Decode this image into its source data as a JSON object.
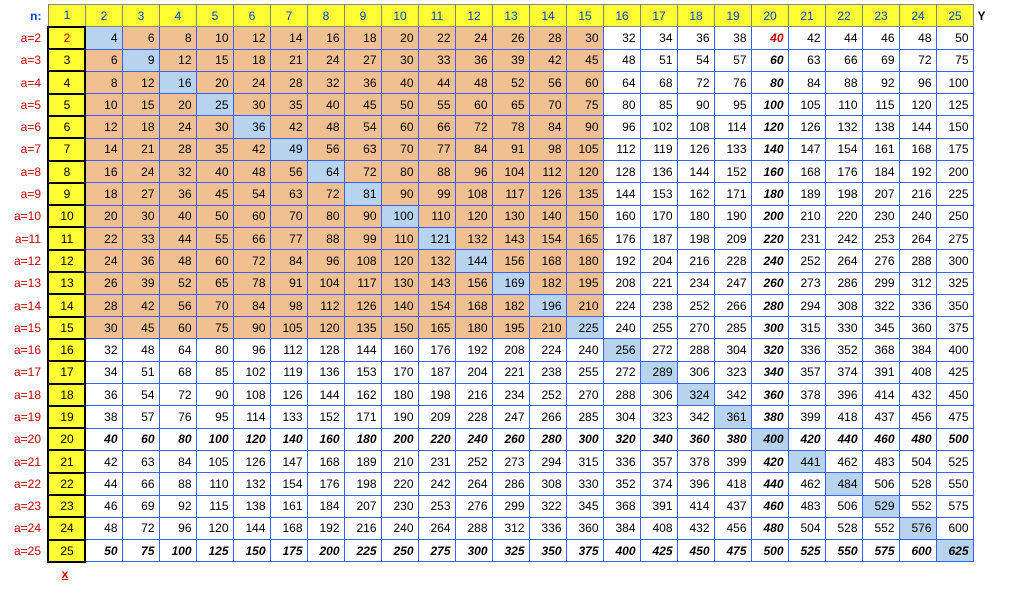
{
  "labels": {
    "n": "n:",
    "aPrefix": "a=",
    "x": "x",
    "y": "Y"
  },
  "cols": [
    1,
    2,
    3,
    4,
    5,
    6,
    7,
    8,
    9,
    10,
    11,
    12,
    13,
    14,
    15,
    16,
    17,
    18,
    19,
    20,
    21,
    22,
    23,
    24,
    25
  ],
  "rows": [
    2,
    3,
    4,
    5,
    6,
    7,
    8,
    9,
    10,
    11,
    12,
    13,
    14,
    15,
    16,
    17,
    18,
    19,
    20,
    21,
    22,
    23,
    24,
    25
  ],
  "shadeUntil": 15,
  "boldItalicRows": [
    20,
    25
  ],
  "boldItalicCols": [
    20
  ],
  "a2RedCols": [
    1,
    20
  ],
  "chart_data": {
    "type": "table",
    "title": "Multiplication table a × n",
    "xlabel": "n",
    "ylabel": "a",
    "x": [
      1,
      2,
      3,
      4,
      5,
      6,
      7,
      8,
      9,
      10,
      11,
      12,
      13,
      14,
      15,
      16,
      17,
      18,
      19,
      20,
      21,
      22,
      23,
      24,
      25
    ],
    "series": [
      {
        "name": "a=2",
        "values": [
          2,
          4,
          6,
          8,
          10,
          12,
          14,
          16,
          18,
          20,
          22,
          24,
          26,
          28,
          30,
          32,
          34,
          36,
          38,
          40,
          42,
          44,
          46,
          48,
          50
        ]
      },
      {
        "name": "a=3",
        "values": [
          3,
          6,
          9,
          12,
          15,
          18,
          21,
          24,
          27,
          30,
          33,
          36,
          39,
          42,
          45,
          48,
          51,
          54,
          57,
          60,
          63,
          66,
          69,
          72,
          75
        ]
      },
      {
        "name": "a=4",
        "values": [
          4,
          8,
          12,
          16,
          20,
          24,
          28,
          32,
          36,
          40,
          44,
          48,
          52,
          56,
          60,
          64,
          68,
          72,
          76,
          80,
          84,
          88,
          92,
          96,
          100
        ]
      },
      {
        "name": "a=5",
        "values": [
          5,
          10,
          15,
          20,
          25,
          30,
          35,
          40,
          45,
          50,
          55,
          60,
          65,
          70,
          75,
          80,
          85,
          90,
          95,
          100,
          105,
          110,
          115,
          120,
          125
        ]
      },
      {
        "name": "a=6",
        "values": [
          6,
          12,
          18,
          24,
          30,
          36,
          42,
          48,
          54,
          60,
          66,
          72,
          78,
          84,
          90,
          96,
          102,
          108,
          114,
          120,
          126,
          132,
          138,
          144,
          150
        ]
      },
      {
        "name": "a=7",
        "values": [
          7,
          14,
          21,
          28,
          35,
          42,
          49,
          56,
          63,
          70,
          77,
          84,
          91,
          98,
          105,
          112,
          119,
          126,
          133,
          140,
          147,
          154,
          161,
          168,
          175
        ]
      },
      {
        "name": "a=8",
        "values": [
          8,
          16,
          24,
          32,
          40,
          48,
          56,
          64,
          72,
          80,
          88,
          96,
          104,
          112,
          120,
          128,
          136,
          144,
          152,
          160,
          168,
          176,
          184,
          192,
          200
        ]
      },
      {
        "name": "a=9",
        "values": [
          9,
          18,
          27,
          36,
          45,
          54,
          63,
          72,
          81,
          90,
          99,
          108,
          117,
          126,
          135,
          144,
          153,
          162,
          171,
          180,
          189,
          198,
          207,
          216,
          225
        ]
      },
      {
        "name": "a=10",
        "values": [
          10,
          20,
          30,
          40,
          50,
          60,
          70,
          80,
          90,
          100,
          110,
          120,
          130,
          140,
          150,
          160,
          170,
          180,
          190,
          200,
          210,
          220,
          230,
          240,
          250
        ]
      },
      {
        "name": "a=11",
        "values": [
          11,
          22,
          33,
          44,
          55,
          66,
          77,
          88,
          99,
          110,
          121,
          132,
          143,
          154,
          165,
          176,
          187,
          198,
          209,
          220,
          231,
          242,
          253,
          264,
          275
        ]
      },
      {
        "name": "a=12",
        "values": [
          12,
          24,
          36,
          48,
          60,
          72,
          84,
          96,
          108,
          120,
          132,
          144,
          156,
          168,
          180,
          192,
          204,
          216,
          228,
          240,
          252,
          264,
          276,
          288,
          300
        ]
      },
      {
        "name": "a=13",
        "values": [
          13,
          26,
          39,
          52,
          65,
          78,
          91,
          104,
          117,
          130,
          143,
          156,
          169,
          182,
          195,
          208,
          221,
          234,
          247,
          260,
          273,
          286,
          299,
          312,
          325
        ]
      },
      {
        "name": "a=14",
        "values": [
          14,
          28,
          42,
          56,
          70,
          84,
          98,
          112,
          126,
          140,
          154,
          168,
          182,
          196,
          210,
          224,
          238,
          252,
          266,
          280,
          294,
          308,
          322,
          336,
          350
        ]
      },
      {
        "name": "a=15",
        "values": [
          15,
          30,
          45,
          60,
          75,
          90,
          105,
          120,
          135,
          150,
          165,
          180,
          195,
          210,
          225,
          240,
          255,
          270,
          285,
          300,
          315,
          330,
          345,
          360,
          375
        ]
      },
      {
        "name": "a=16",
        "values": [
          16,
          32,
          48,
          64,
          80,
          96,
          112,
          128,
          144,
          160,
          176,
          192,
          208,
          224,
          240,
          256,
          272,
          288,
          304,
          320,
          336,
          352,
          368,
          384,
          400
        ]
      },
      {
        "name": "a=17",
        "values": [
          17,
          34,
          51,
          68,
          85,
          102,
          119,
          136,
          153,
          170,
          187,
          204,
          221,
          238,
          255,
          272,
          289,
          306,
          323,
          340,
          357,
          374,
          391,
          408,
          425
        ]
      },
      {
        "name": "a=18",
        "values": [
          18,
          36,
          54,
          72,
          90,
          108,
          126,
          144,
          162,
          180,
          198,
          216,
          234,
          252,
          270,
          288,
          306,
          324,
          342,
          360,
          378,
          396,
          414,
          432,
          450
        ]
      },
      {
        "name": "a=19",
        "values": [
          19,
          38,
          57,
          76,
          95,
          114,
          133,
          152,
          171,
          190,
          209,
          228,
          247,
          266,
          285,
          304,
          323,
          342,
          361,
          380,
          399,
          418,
          437,
          456,
          475
        ]
      },
      {
        "name": "a=20",
        "values": [
          20,
          40,
          60,
          80,
          100,
          120,
          140,
          160,
          180,
          200,
          220,
          240,
          260,
          280,
          300,
          320,
          340,
          360,
          380,
          400,
          420,
          440,
          460,
          480,
          500
        ]
      },
      {
        "name": "a=21",
        "values": [
          21,
          42,
          63,
          84,
          105,
          126,
          147,
          168,
          189,
          210,
          231,
          252,
          273,
          294,
          315,
          336,
          357,
          378,
          399,
          420,
          441,
          462,
          483,
          504,
          525
        ]
      },
      {
        "name": "a=22",
        "values": [
          22,
          44,
          66,
          88,
          110,
          132,
          154,
          176,
          198,
          220,
          242,
          264,
          286,
          308,
          330,
          352,
          374,
          396,
          418,
          440,
          462,
          484,
          506,
          528,
          550
        ]
      },
      {
        "name": "a=23",
        "values": [
          23,
          46,
          69,
          92,
          115,
          138,
          161,
          184,
          207,
          230,
          253,
          276,
          299,
          322,
          345,
          368,
          391,
          414,
          437,
          460,
          483,
          506,
          529,
          552,
          575
        ]
      },
      {
        "name": "a=24",
        "values": [
          24,
          48,
          72,
          96,
          120,
          144,
          168,
          192,
          216,
          240,
          264,
          288,
          312,
          336,
          360,
          384,
          408,
          432,
          456,
          480,
          504,
          528,
          552,
          576,
          600
        ]
      },
      {
        "name": "a=25",
        "values": [
          25,
          50,
          75,
          100,
          125,
          150,
          175,
          200,
          225,
          250,
          275,
          300,
          325,
          350,
          375,
          400,
          425,
          450,
          475,
          500,
          525,
          550,
          575,
          600,
          625
        ]
      }
    ]
  }
}
